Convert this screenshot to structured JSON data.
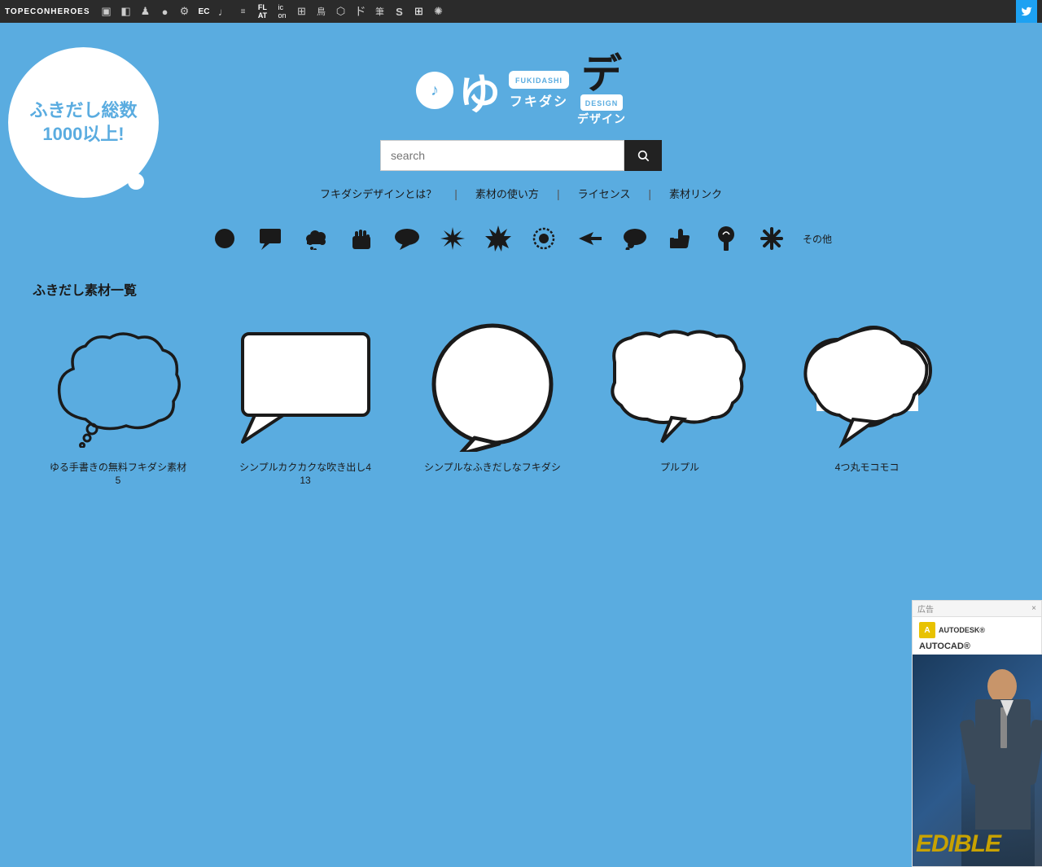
{
  "topnav": {
    "brand": "TOPECONHEROES",
    "icons": [
      "▣",
      "◧",
      "♟",
      "●",
      "⚙",
      "EC",
      "♩",
      "≡",
      "FL AT",
      "ic on",
      "⊞",
      "鳥",
      "⬡",
      "ド",
      "筆",
      "S",
      "⊞",
      "✺"
    ],
    "twitter_label": "🐦"
  },
  "hero_bubble": {
    "line1": "ふきだし総数",
    "line2": "1000以上!"
  },
  "logo": {
    "circle_char": "♪",
    "kana": "ゆ",
    "fukidashi": "FUKIDASHI\nフキダシ",
    "design_kana": "デ",
    "design_label": "DESIGN\nデザイン"
  },
  "search": {
    "placeholder": "search",
    "button_label": "🔍"
  },
  "nav_links": [
    {
      "label": "フキダシデザインとは？"
    },
    {
      "label": "素材の使い方"
    },
    {
      "label": "ライセンス"
    },
    {
      "label": "素材リンク"
    }
  ],
  "category_icons": [
    {
      "name": "circle",
      "symbol": "●"
    },
    {
      "name": "rect-bubble",
      "symbol": "💬"
    },
    {
      "name": "cloud",
      "symbol": "❋"
    },
    {
      "name": "hand",
      "symbol": "✋"
    },
    {
      "name": "oval-bubble",
      "symbol": "💭"
    },
    {
      "name": "star-burst",
      "symbol": "✳"
    },
    {
      "name": "spiky",
      "symbol": "✺"
    },
    {
      "name": "dotted-circle",
      "symbol": "◉"
    },
    {
      "name": "arrow",
      "symbol": "⌐"
    },
    {
      "name": "speech-round",
      "symbol": "💬"
    },
    {
      "name": "thumb-up",
      "symbol": "👍"
    },
    {
      "name": "spiral",
      "symbol": "🌀"
    },
    {
      "name": "cross",
      "symbol": "✛"
    },
    {
      "name": "others",
      "symbol": "その他"
    }
  ],
  "section_title": "ふきだし素材一覧",
  "cards": [
    {
      "title": "ゆる手書きの無料フキダシ素材",
      "count": "5",
      "type": "cloud"
    },
    {
      "title": "シンプルカクカクな吹き出し4",
      "count": "13",
      "type": "rect"
    },
    {
      "title": "シンプルなふきだしなフキダシ",
      "count": "",
      "type": "oval"
    },
    {
      "title": "プルプル",
      "count": "",
      "type": "wobbly"
    },
    {
      "title": "4つ丸モコモコ",
      "count": "",
      "type": "mokomoko"
    }
  ],
  "ad": {
    "label": "広告",
    "close": "×",
    "logo_letter": "A",
    "brand": "AUTODESK®",
    "product": "AUTOCAD®",
    "overlay": "EDIBLE"
  }
}
